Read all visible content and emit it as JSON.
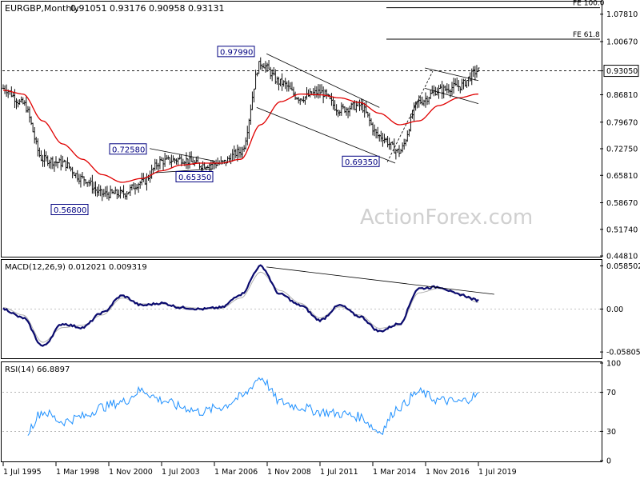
{
  "header": {
    "symbol": "EURGBP,Monthly",
    "ohlc": "0.91051 0.93176 0.90958 0.93131"
  },
  "watermark": "ActionForex.com",
  "colors": {
    "price_bars": "#111111",
    "sma": "#e00000",
    "macd_line": "#0a0a6e",
    "signal_line": "#b0b0b0",
    "rsi_line": "#1e90ff",
    "trendline": "#000000",
    "label_box_border": "#000080",
    "axis": "#000000",
    "grid_dash": "#888888"
  },
  "chart_data": [
    {
      "type": "candlestick",
      "title": "EURGBP,Monthly",
      "ylim": [
        0.4482,
        1.1088
      ],
      "y_ticks": [
        "1.07810",
        "1.00670",
        "0.93050",
        "0.86810",
        "0.79670",
        "0.72750",
        "0.65810",
        "0.58670",
        "0.51740",
        "0.44810"
      ],
      "current_price_label": "0.93050",
      "horizontal_lines": [
        {
          "label": "FE 100.0",
          "value": 1.095
        },
        {
          "label": "FE 61.8",
          "value": 1.013
        },
        {
          "value": 0.9305,
          "style": "dashed"
        }
      ],
      "annotations": [
        {
          "text": "0.97990",
          "value": 0.9799
        },
        {
          "text": "0.72580",
          "value": 0.7258
        },
        {
          "text": "0.65350",
          "value": 0.6535
        },
        {
          "text": "0.56800",
          "value": 0.568
        },
        {
          "text": "0.69350",
          "value": 0.6935
        }
      ],
      "series": [
        {
          "name": "price",
          "x": [
            "1995",
            "1996",
            "1997",
            "1998",
            "1999",
            "2000",
            "2001",
            "2002",
            "2003",
            "2004",
            "2005",
            "2006",
            "2007",
            "2008",
            "2009",
            "2010",
            "2011",
            "2012",
            "2013",
            "2014",
            "2015",
            "2016",
            "2017",
            "2018",
            "2019"
          ],
          "values": [
            0.885,
            0.845,
            0.7,
            0.69,
            0.65,
            0.61,
            0.61,
            0.64,
            0.695,
            0.7,
            0.685,
            0.69,
            0.72,
            0.95,
            0.9,
            0.86,
            0.875,
            0.83,
            0.84,
            0.76,
            0.72,
            0.85,
            0.88,
            0.89,
            0.931
          ]
        },
        {
          "name": "sma",
          "x": [
            "1995",
            "1996",
            "1997",
            "1998",
            "1999",
            "2000",
            "2001",
            "2002",
            "2003",
            "2004",
            "2005",
            "2006",
            "2007",
            "2008",
            "2009",
            "2010",
            "2011",
            "2012",
            "2013",
            "2014",
            "2015",
            "2016",
            "2017",
            "2018",
            "2019"
          ],
          "values": [
            0.88,
            0.87,
            0.8,
            0.74,
            0.7,
            0.66,
            0.64,
            0.65,
            0.67,
            0.685,
            0.69,
            0.69,
            0.7,
            0.79,
            0.85,
            0.87,
            0.868,
            0.86,
            0.848,
            0.82,
            0.79,
            0.8,
            0.84,
            0.86,
            0.87
          ]
        }
      ]
    },
    {
      "type": "line",
      "title": "MACD(12,26,9) 0.012021 0.009319",
      "ylim": [
        -0.0655,
        0.0655
      ],
      "y_ticks": [
        "0.058502",
        "0.00",
        "-0.058054"
      ],
      "current_value_label": "0.00",
      "series": [
        {
          "name": "macd",
          "x": [
            "1995",
            "1996",
            "1997",
            "1998",
            "1999",
            "2000",
            "2001",
            "2002",
            "2003",
            "2004",
            "2005",
            "2006",
            "2007",
            "2008",
            "2009",
            "2010",
            "2011",
            "2012",
            "2013",
            "2014",
            "2015",
            "2016",
            "2017",
            "2018",
            "2019"
          ],
          "values": [
            0.0,
            -0.012,
            -0.05,
            -0.02,
            -0.025,
            -0.005,
            0.018,
            0.005,
            0.008,
            0.002,
            0.0,
            0.002,
            0.02,
            0.058,
            0.02,
            0.005,
            -0.015,
            0.005,
            -0.01,
            -0.03,
            -0.02,
            0.028,
            0.03,
            0.02,
            0.012
          ]
        },
        {
          "name": "signal",
          "x": [
            "1995",
            "1996",
            "1997",
            "1998",
            "1999",
            "2000",
            "2001",
            "2002",
            "2003",
            "2004",
            "2005",
            "2006",
            "2007",
            "2008",
            "2009",
            "2010",
            "2011",
            "2012",
            "2013",
            "2014",
            "2015",
            "2016",
            "2017",
            "2018",
            "2019"
          ],
          "values": [
            0.002,
            -0.008,
            -0.045,
            -0.025,
            -0.022,
            -0.008,
            0.015,
            0.007,
            0.007,
            0.003,
            0.001,
            0.001,
            0.015,
            0.05,
            0.025,
            0.008,
            -0.012,
            0.003,
            -0.008,
            -0.026,
            -0.022,
            0.022,
            0.028,
            0.021,
            0.009
          ]
        }
      ]
    },
    {
      "type": "line",
      "title": "RSI(14) 66.8897",
      "ylim": [
        0,
        100
      ],
      "y_ticks": [
        "100",
        "70",
        "30",
        "0"
      ],
      "levels": [
        70,
        30
      ],
      "series": [
        {
          "name": "rsi",
          "x": [
            "1995",
            "1996",
            "1997",
            "1998",
            "1999",
            "2000",
            "2001",
            "2002",
            "2003",
            "2004",
            "2005",
            "2006",
            "2007",
            "2008",
            "2009",
            "2010",
            "2011",
            "2012",
            "2013",
            "2014",
            "2015",
            "2016",
            "2017",
            "2018",
            "2019"
          ],
          "values": [
            30,
            25,
            50,
            40,
            45,
            55,
            60,
            72,
            62,
            55,
            50,
            55,
            65,
            85,
            60,
            55,
            50,
            48,
            45,
            30,
            55,
            70,
            62,
            60,
            66.9
          ]
        }
      ]
    },
    {
      "type": "x-axis",
      "x_ticks": [
        "1 Jul 1995",
        "1 Mar 1998",
        "1 Nov 2000",
        "1 Jul 2003",
        "1 Mar 2006",
        "1 Nov 2008",
        "1 Jul 2011",
        "1 Mar 2014",
        "1 Nov 2016",
        "1 Jul 2019"
      ]
    }
  ]
}
